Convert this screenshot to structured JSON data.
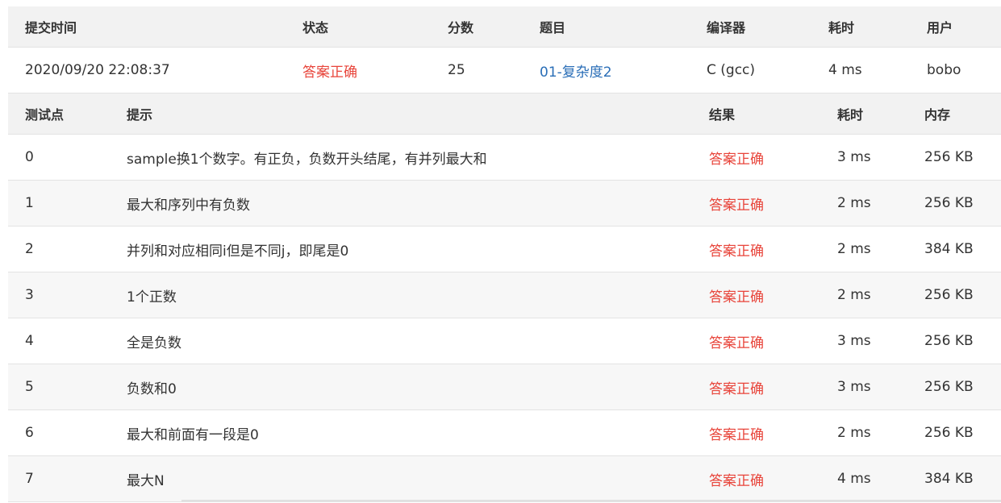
{
  "submission": {
    "headers": [
      "提交时间",
      "状态",
      "分数",
      "题目",
      "编译器",
      "耗时",
      "用户"
    ],
    "row": {
      "time": "2020/09/20 22:08:37",
      "status": "答案正确",
      "score": "25",
      "problem": "01-复杂度2",
      "compiler": "C (gcc)",
      "elapsed": "4 ms",
      "user": "bobo"
    }
  },
  "testcases": {
    "headers": [
      "测试点",
      "提示",
      "结果",
      "耗时",
      "内存"
    ],
    "rows": [
      {
        "id": "0",
        "hint": "sample换1个数字。有正负，负数开头结尾，有并列最大和",
        "result": "答案正确",
        "time": "3 ms",
        "memory": "256 KB"
      },
      {
        "id": "1",
        "hint": "最大和序列中有负数",
        "result": "答案正确",
        "time": "2 ms",
        "memory": "256 KB"
      },
      {
        "id": "2",
        "hint": "并列和对应相同i但是不同j，即尾是0",
        "result": "答案正确",
        "time": "2 ms",
        "memory": "384 KB"
      },
      {
        "id": "3",
        "hint": "1个正数",
        "result": "答案正确",
        "time": "2 ms",
        "memory": "256 KB"
      },
      {
        "id": "4",
        "hint": "全是负数",
        "result": "答案正确",
        "time": "3 ms",
        "memory": "256 KB"
      },
      {
        "id": "5",
        "hint": "负数和0",
        "result": "答案正确",
        "time": "3 ms",
        "memory": "256 KB"
      },
      {
        "id": "6",
        "hint": "最大和前面有一段是0",
        "result": "答案正确",
        "time": "2 ms",
        "memory": "256 KB"
      },
      {
        "id": "7",
        "hint": "最大N",
        "result": "答案正确",
        "time": "4 ms",
        "memory": "384 KB"
      }
    ]
  },
  "colors": {
    "accepted": "#e8443a",
    "link": "#2a6eb7",
    "header_bg": "#f2f2f2",
    "alt_row_bg": "#f7f7f7"
  }
}
